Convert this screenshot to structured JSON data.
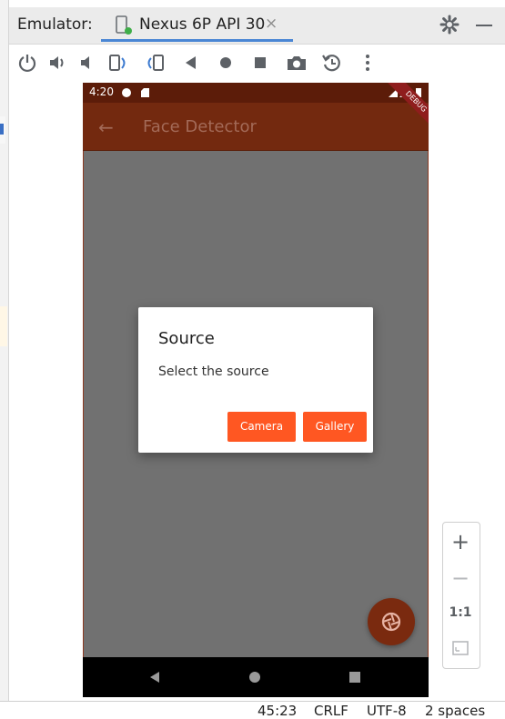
{
  "window": {
    "title": "Emulator:",
    "tab_label": "Nexus 6P API 30",
    "tab_close": "×"
  },
  "toolbar": {
    "icons": [
      "power-icon",
      "volume-up-icon",
      "volume-down-icon",
      "rotate-left-icon",
      "rotate-right-icon",
      "back-icon",
      "home-icon",
      "overview-icon",
      "screenshot-icon",
      "snapshot-icon",
      "more-icon"
    ]
  },
  "device": {
    "status_time": "4:20",
    "debug_banner": "DEBUG",
    "app_title": "Face Detector"
  },
  "dialog": {
    "title": "Source",
    "message": "Select the source",
    "camera_button": "Camera",
    "gallery_button": "Gallery"
  },
  "zoom": {
    "zoom_in": "+",
    "zoom_out": "−",
    "actual_size": "1:1"
  },
  "ide_status": {
    "position": "45:23",
    "line_sep": "CRLF",
    "encoding": "UTF-8",
    "indent": "2 spaces"
  },
  "colors": {
    "app_bar": "#73290f",
    "status_bar": "#5c1c09",
    "dialog_button": "#ff5722",
    "fab": "#7a2a0f"
  }
}
